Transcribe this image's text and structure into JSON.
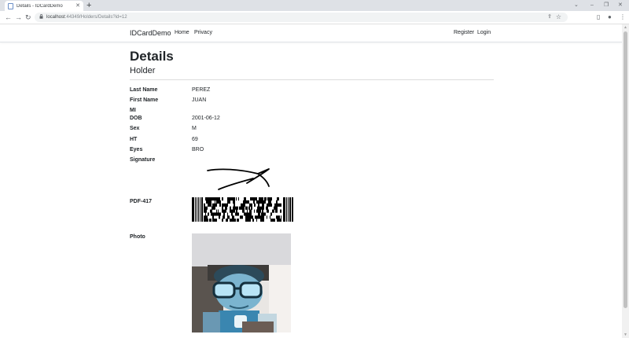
{
  "browser": {
    "tab_title": "Details - IDCardDemo",
    "new_tab": "+",
    "url_host": "localhost",
    "url_path": ":44349/Holders/Details?id=12",
    "window_controls": {
      "minimize": "–",
      "restore": "❐",
      "close": "✕",
      "collapse": "⌄"
    }
  },
  "icons": {
    "back": "←",
    "forward": "→",
    "reload": "↻",
    "lock": "🔒",
    "star": "☆",
    "share": "⇪",
    "sidepanel": "▯",
    "profile": "●",
    "menu": "⋮",
    "tab_close": "✕"
  },
  "nav": {
    "brand": "IDCardDemo",
    "home": "Home",
    "privacy": "Privacy",
    "register": "Register",
    "login": "Login"
  },
  "page": {
    "title": "Details",
    "subtitle": "Holder"
  },
  "details": {
    "last_name": {
      "label": "Last Name",
      "value": "PEREZ"
    },
    "first_name": {
      "label": "First Name",
      "value": "JUAN"
    },
    "mi": {
      "label": "MI",
      "value": ""
    },
    "dob": {
      "label": "DOB",
      "value": "2001-06-12"
    },
    "sex": {
      "label": "Sex",
      "value": "M"
    },
    "ht": {
      "label": "HT",
      "value": "69"
    },
    "eyes": {
      "label": "Eyes",
      "value": "BRO"
    },
    "signature": {
      "label": "Signature"
    },
    "pdf417": {
      "label": "PDF-417"
    },
    "photo": {
      "label": "Photo"
    }
  },
  "colors": {
    "text": "#212529",
    "tabstrip": "#dee1e6",
    "omnibox": "#f1f3f4",
    "photo_figure": "#3a86b0"
  }
}
